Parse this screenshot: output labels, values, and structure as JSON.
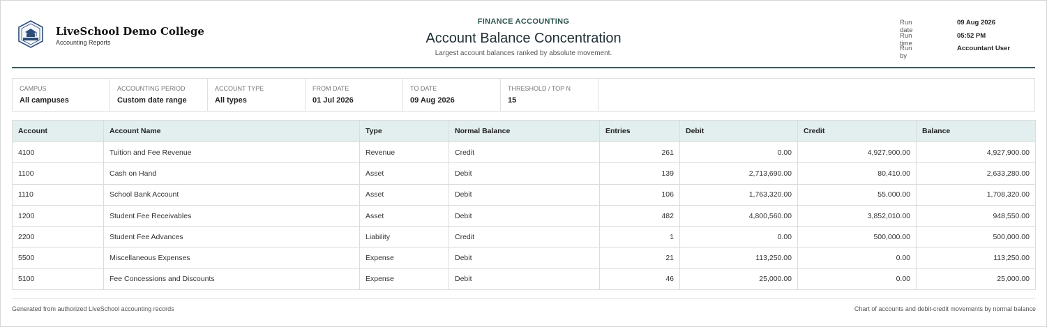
{
  "header": {
    "org_name": "LiveSchool Demo College",
    "org_sub": "Accounting Reports",
    "kicker": "FINANCE ACCOUNTING",
    "title": "Account Balance Concentration",
    "subtitle": "Largest account balances ranked by absolute movement.",
    "meta": [
      {
        "label": "Run date",
        "value": "09 Aug 2026"
      },
      {
        "label": "Run time",
        "value": "05:52 PM"
      },
      {
        "label": "Run by",
        "value": "Accountant User"
      }
    ],
    "accent_color": "#3b5a5c"
  },
  "filters": [
    {
      "label": "CAMPUS",
      "value": "All campuses"
    },
    {
      "label": "ACCOUNTING PERIOD",
      "value": "Custom date range"
    },
    {
      "label": "ACCOUNT TYPE",
      "value": "All types"
    },
    {
      "label": "FROM DATE",
      "value": "01 Jul 2026"
    },
    {
      "label": "TO DATE",
      "value": "09 Aug 2026"
    },
    {
      "label": "THRESHOLD / TOP N",
      "value": "15"
    }
  ],
  "table": {
    "columns": [
      "Account",
      "Account Name",
      "Type",
      "Normal Balance",
      "Entries",
      "Debit",
      "Credit",
      "Balance"
    ],
    "rows": [
      [
        "4100",
        "Tuition and Fee Revenue",
        "Revenue",
        "Credit",
        "261",
        "0.00",
        "4,927,900.00",
        "4,927,900.00"
      ],
      [
        "1100",
        "Cash on Hand",
        "Asset",
        "Debit",
        "139",
        "2,713,690.00",
        "80,410.00",
        "2,633,280.00"
      ],
      [
        "1110",
        "School Bank Account",
        "Asset",
        "Debit",
        "106",
        "1,763,320.00",
        "55,000.00",
        "1,708,320.00"
      ],
      [
        "1200",
        "Student Fee Receivables",
        "Asset",
        "Debit",
        "482",
        "4,800,560.00",
        "3,852,010.00",
        "948,550.00"
      ],
      [
        "2200",
        "Student Fee Advances",
        "Liability",
        "Credit",
        "1",
        "0.00",
        "500,000.00",
        "500,000.00"
      ],
      [
        "5500",
        "Miscellaneous Expenses",
        "Expense",
        "Debit",
        "21",
        "113,250.00",
        "0.00",
        "113,250.00"
      ],
      [
        "5100",
        "Fee Concessions and Discounts",
        "Expense",
        "Debit",
        "46",
        "25,000.00",
        "0.00",
        "25,000.00"
      ]
    ],
    "header_bg": "#e2efee"
  },
  "footer": {
    "left": "Generated from authorized LiveSchool accounting records",
    "right": "Chart of accounts and debit-credit movements by normal balance"
  }
}
